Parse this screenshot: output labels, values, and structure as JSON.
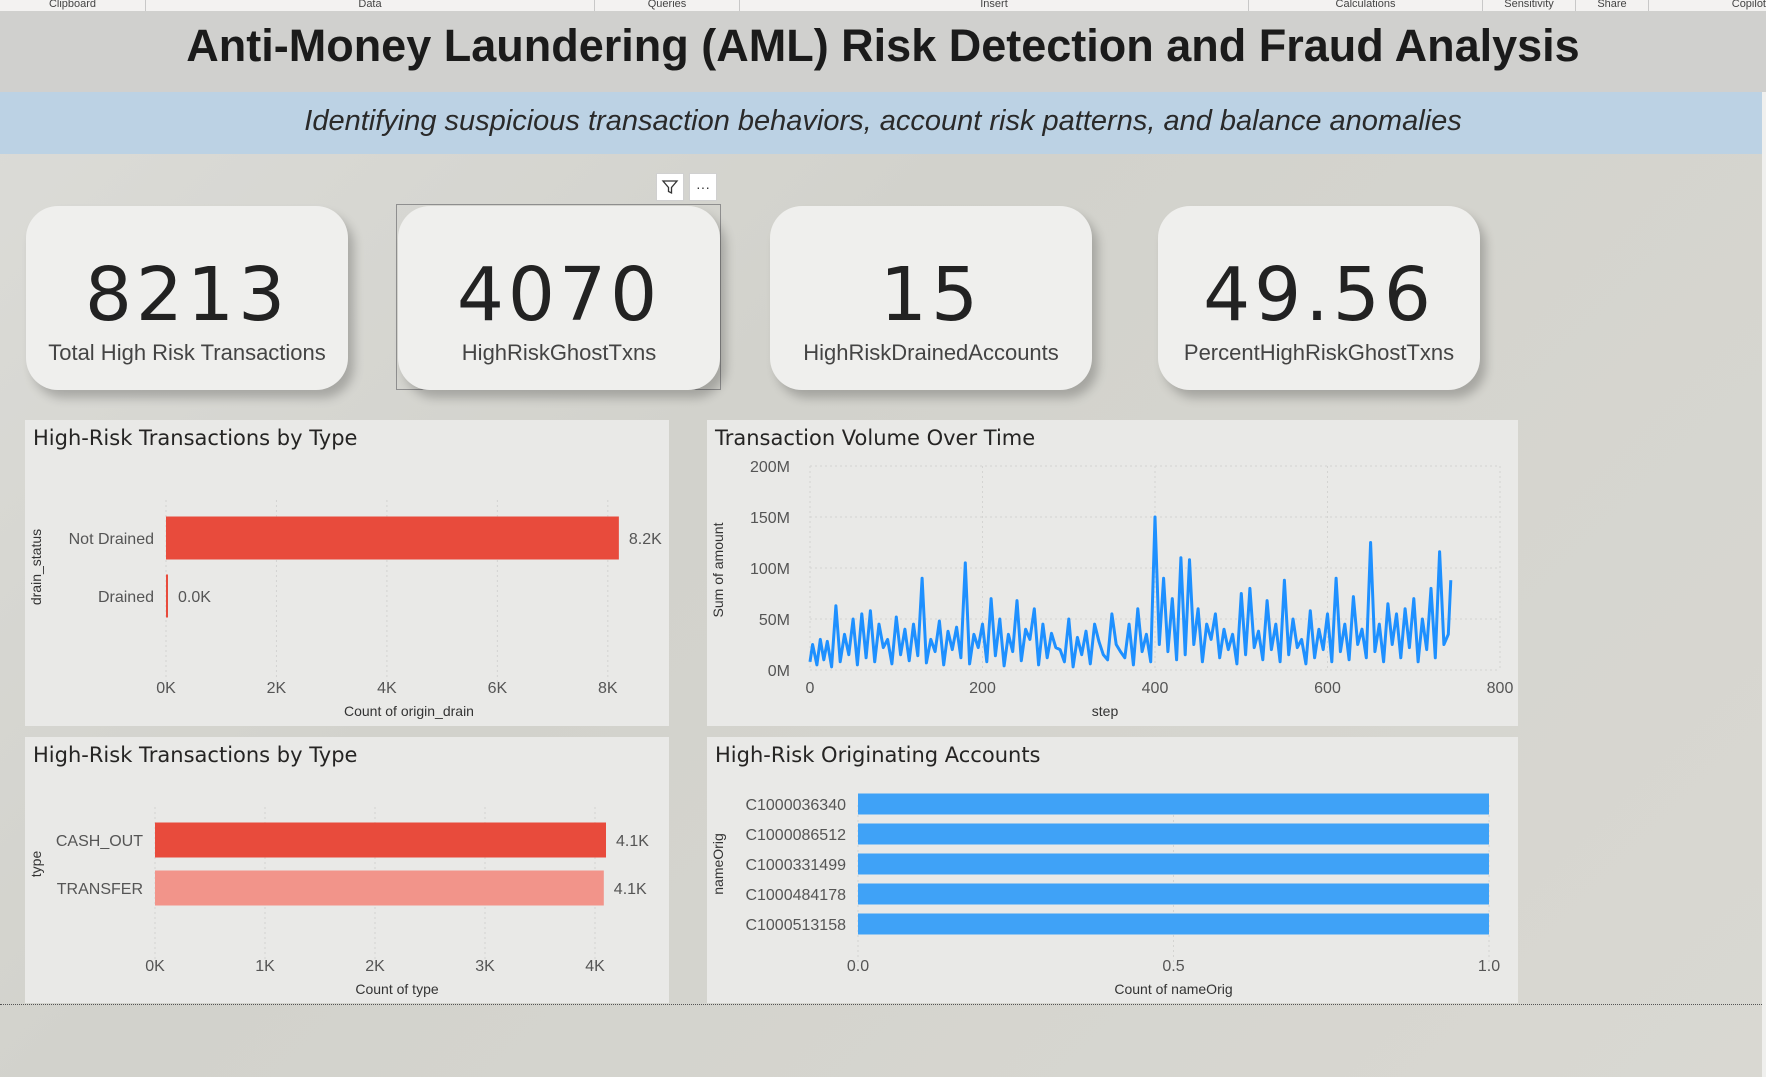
{
  "ribbon": {
    "groups": [
      {
        "label": "Clipboard"
      },
      {
        "label": "Data"
      },
      {
        "label": "Queries"
      },
      {
        "label": "Insert"
      },
      {
        "label": "Calculations"
      },
      {
        "label": "Sensitivity"
      },
      {
        "label": "Share"
      },
      {
        "label": "Copilot"
      }
    ]
  },
  "header": {
    "title": "Anti-Money Laundering (AML) Risk Detection and Fraud Analysis",
    "subtitle": "Identifying suspicious transaction behaviors, account risk patterns, and balance anomalies"
  },
  "visual_header": {
    "filter_icon": "filter-icon",
    "more_icon": "more-options-icon",
    "more_label": "···"
  },
  "kpis": [
    {
      "value": "8213",
      "label": "Total High Risk Transactions"
    },
    {
      "value": "4070",
      "label": "HighRiskGhostTxns"
    },
    {
      "value": "15",
      "label": "HighRiskDrainedAccounts"
    },
    {
      "value": "49.56",
      "label": "PercentHighRiskGhostTxns"
    }
  ],
  "colors": {
    "red": "#e84b3c",
    "light_red": "#f2948a",
    "blue": "#1e90ff",
    "bar_blue": "#3fa2f7"
  },
  "chart_data": [
    {
      "id": "drain",
      "type": "bar",
      "orientation": "horizontal",
      "title": "High-Risk Transactions by Type",
      "xlabel": "Count of origin_drain",
      "ylabel": "drain_status",
      "categories": [
        "Not Drained",
        "Drained"
      ],
      "values": [
        8200,
        20
      ],
      "data_labels": [
        "8.2K",
        "0.0K"
      ],
      "xlim": [
        0,
        8800
      ],
      "ticks": [
        0,
        2000,
        4000,
        6000,
        8000
      ],
      "tick_labels": [
        "0K",
        "2K",
        "4K",
        "6K",
        "8K"
      ],
      "colors": [
        "#e84b3c",
        "#e84b3c"
      ]
    },
    {
      "id": "volume",
      "type": "line",
      "title": "Transaction Volume Over Time",
      "xlabel": "step",
      "ylabel": "Sum of amount",
      "xlim": [
        0,
        800
      ],
      "ylim": [
        0,
        200000000
      ],
      "xticks": [
        0,
        200,
        400,
        600,
        800
      ],
      "xtick_labels": [
        "0",
        "200",
        "400",
        "600",
        "800"
      ],
      "yticks": [
        0,
        50000000,
        100000000,
        150000000,
        200000000
      ],
      "ytick_labels": [
        "0M",
        "50M",
        "100M",
        "150M",
        "200M"
      ],
      "grid": true,
      "x": [
        0,
        3,
        8,
        12,
        16,
        20,
        25,
        30,
        35,
        40,
        45,
        50,
        55,
        60,
        65,
        70,
        75,
        80,
        85,
        90,
        95,
        100,
        105,
        110,
        115,
        120,
        125,
        130,
        135,
        140,
        145,
        150,
        155,
        160,
        165,
        170,
        175,
        180,
        185,
        190,
        195,
        200,
        205,
        210,
        215,
        220,
        225,
        230,
        235,
        240,
        245,
        250,
        255,
        260,
        265,
        270,
        275,
        280,
        285,
        290,
        295,
        300,
        305,
        310,
        315,
        320,
        325,
        330,
        335,
        340,
        345,
        350,
        355,
        360,
        365,
        370,
        375,
        380,
        385,
        390,
        395,
        400,
        405,
        410,
        415,
        420,
        425,
        430,
        435,
        440,
        445,
        450,
        455,
        460,
        465,
        470,
        475,
        480,
        485,
        490,
        495,
        500,
        505,
        510,
        515,
        520,
        525,
        530,
        535,
        540,
        545,
        550,
        555,
        560,
        565,
        570,
        575,
        580,
        585,
        590,
        595,
        600,
        605,
        610,
        615,
        620,
        625,
        630,
        635,
        640,
        645,
        650,
        655,
        660,
        665,
        670,
        675,
        680,
        685,
        690,
        695,
        700,
        705,
        710,
        715,
        720,
        725,
        730,
        735,
        740,
        743
      ],
      "y": [
        8,
        25,
        5,
        30,
        10,
        28,
        3,
        63,
        8,
        35,
        15,
        50,
        5,
        55,
        12,
        58,
        8,
        45,
        22,
        30,
        6,
        52,
        15,
        40,
        9,
        45,
        14,
        90,
        7,
        30,
        18,
        48,
        5,
        38,
        20,
        42,
        12,
        105,
        6,
        35,
        22,
        45,
        8,
        70,
        14,
        50,
        4,
        35,
        18,
        68,
        9,
        40,
        30,
        60,
        5,
        45,
        12,
        36,
        22,
        20,
        8,
        50,
        3,
        32,
        15,
        38,
        6,
        45,
        28,
        15,
        10,
        55,
        25,
        18,
        12,
        45,
        5,
        60,
        18,
        35,
        8,
        150,
        25,
        90,
        18,
        70,
        10,
        110,
        15,
        108,
        25,
        60,
        8,
        45,
        30,
        55,
        12,
        40,
        20,
        35,
        6,
        75,
        15,
        80,
        22,
        38,
        10,
        68,
        20,
        45,
        8,
        88,
        15,
        50,
        22,
        30,
        6,
        58,
        12,
        40,
        20,
        55,
        8,
        90,
        18,
        45,
        10,
        72,
        25,
        40,
        12,
        125,
        18,
        45,
        8,
        65,
        25,
        55,
        12,
        60,
        22,
        70,
        8,
        50,
        20,
        80,
        12,
        116,
        25,
        35,
        88
      ],
      "y_unit": "M",
      "color": "#1e90ff"
    },
    {
      "id": "type",
      "type": "bar",
      "orientation": "horizontal",
      "title": "High-Risk Transactions by Type",
      "xlabel": "Count of type",
      "ylabel": "type",
      "categories": [
        "CASH_OUT",
        "TRANSFER"
      ],
      "values": [
        4100,
        4080
      ],
      "data_labels": [
        "4.1K",
        "4.1K"
      ],
      "xlim": [
        0,
        4400
      ],
      "ticks": [
        0,
        1000,
        2000,
        3000,
        4000
      ],
      "tick_labels": [
        "0K",
        "1K",
        "2K",
        "3K",
        "4K"
      ],
      "colors": [
        "#e84b3c",
        "#f2948a"
      ]
    },
    {
      "id": "accounts",
      "type": "bar",
      "orientation": "horizontal",
      "title": "High-Risk Originating Accounts",
      "xlabel": "Count of nameOrig",
      "ylabel": "nameOrig",
      "categories": [
        "C1000036340",
        "C1000086512",
        "C1000331499",
        "C1000484178",
        "C1000513158"
      ],
      "values": [
        1,
        1,
        1,
        1,
        1
      ],
      "xlim": [
        0,
        1
      ],
      "ticks": [
        0,
        0.5,
        1
      ],
      "tick_labels": [
        "0.0",
        "0.5",
        "1.0"
      ],
      "colors": [
        "#3fa2f7",
        "#3fa2f7",
        "#3fa2f7",
        "#3fa2f7",
        "#3fa2f7"
      ]
    }
  ]
}
